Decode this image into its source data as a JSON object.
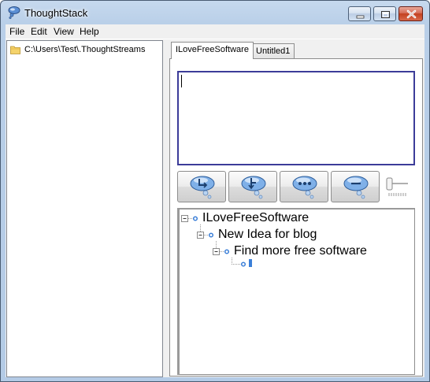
{
  "window": {
    "title": "ThoughtStack",
    "controls": [
      "minimize",
      "maximize",
      "close"
    ]
  },
  "menu": [
    "File",
    "Edit",
    "View",
    "Help"
  ],
  "explorer": {
    "path": "C:\\Users\\Test\\.ThoughtStreams",
    "icon": "folder-icon"
  },
  "tabs": [
    {
      "label": "ILoveFreeSoftware",
      "active": true
    },
    {
      "label": "Untitled1",
      "active": false
    }
  ],
  "editor": {
    "value": ""
  },
  "toolbar": {
    "buttons": [
      "add-child-thought-icon",
      "add-sibling-thought-icon",
      "more-options-icon",
      "remove-thought-icon"
    ],
    "slider": "zoom-slider"
  },
  "tree": {
    "root": "ILoveFreeSoftware",
    "child": "New Idea for blog",
    "grandchild": "Find more free software",
    "new_node": ""
  },
  "colors": {
    "titlebar": "#b9cfe8",
    "close_button": "#c3401f",
    "editor_border": "#3c3c99",
    "node_bullet": "#3b7fd8"
  }
}
